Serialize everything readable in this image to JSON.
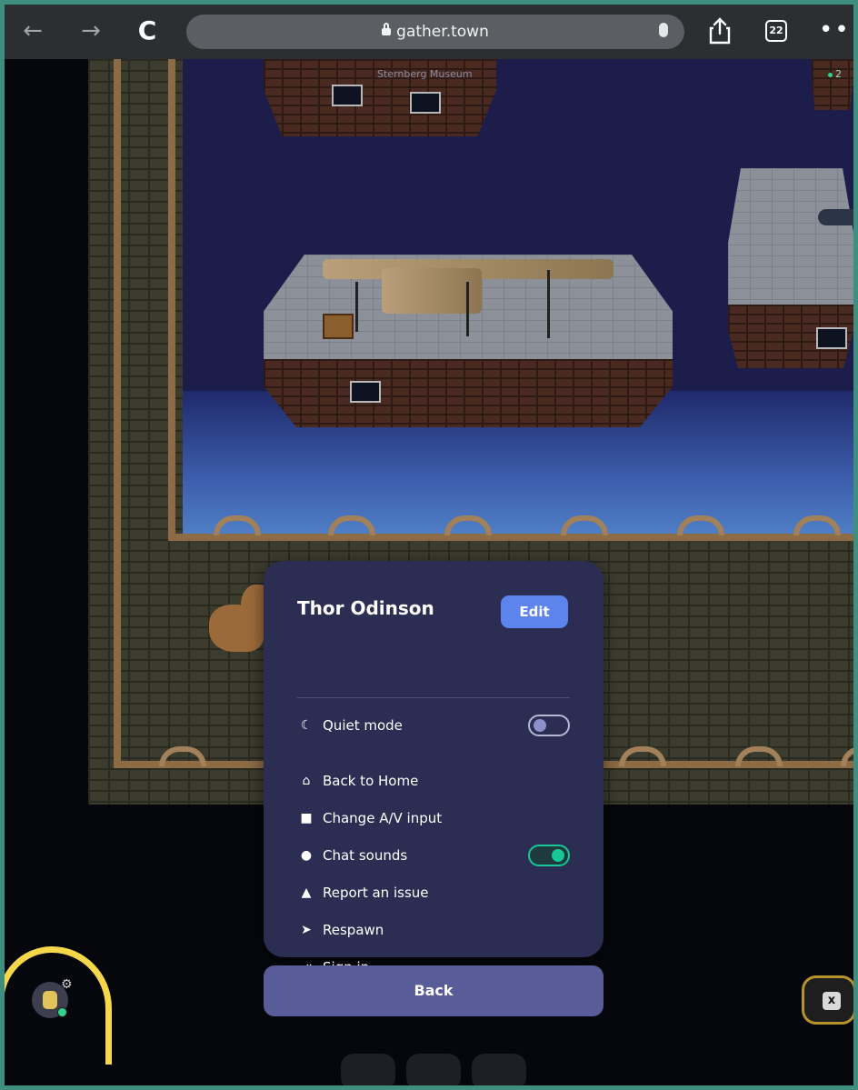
{
  "browser": {
    "url": "gather.town",
    "tab_count": "22",
    "back_icon": "←",
    "forward_icon": "→",
    "reload_icon": "C",
    "more_icon": "•••"
  },
  "map": {
    "room_label": "Sternberg Museum",
    "online_count": "2"
  },
  "menu": {
    "user_name": "Thor Odinson",
    "edit_label": "Edit",
    "quiet_mode": {
      "label": "Quiet mode",
      "icon": "☾",
      "enabled": false
    },
    "items": [
      {
        "label": "Back to Home",
        "icon": "⌂"
      },
      {
        "label": "Change A/V input",
        "icon": "■"
      },
      {
        "label": "Chat sounds",
        "icon": "●",
        "toggle": true,
        "enabled": true
      },
      {
        "label": "Report an issue",
        "icon": "▲"
      },
      {
        "label": "Respawn",
        "icon": "➤"
      },
      {
        "label": "Sign in",
        "icon": "⇥"
      }
    ]
  },
  "back_button": {
    "label": "Back"
  },
  "close_button": {
    "label": "x"
  },
  "colors": {
    "menu_bg": "#2b2d52",
    "accent": "#5d84ec",
    "toggle_on": "#17c796",
    "highlight": "#f6d74a"
  }
}
